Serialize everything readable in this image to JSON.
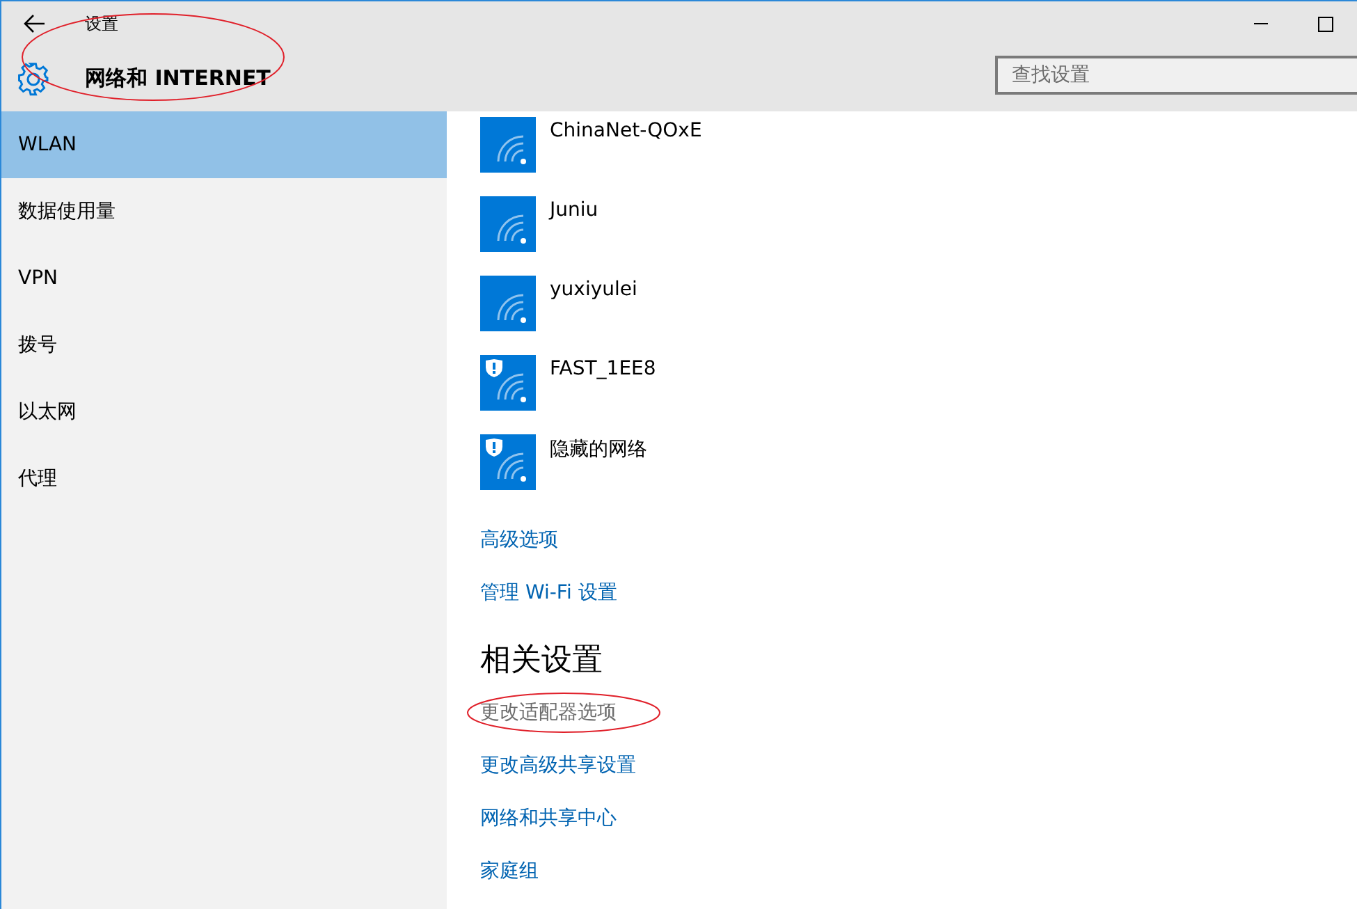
{
  "window": {
    "title": "设置"
  },
  "header": {
    "title": "网络和 INTERNET",
    "search": {
      "placeholder": "查找设置"
    }
  },
  "sidebar": {
    "items": [
      {
        "label": "WLAN",
        "selected": true
      },
      {
        "label": "数据使用量",
        "selected": false
      },
      {
        "label": "VPN",
        "selected": false
      },
      {
        "label": "拨号",
        "selected": false
      },
      {
        "label": "以太网",
        "selected": false
      },
      {
        "label": "代理",
        "selected": false
      }
    ]
  },
  "networks": [
    {
      "name": "ChinaNet-QOxE",
      "warning": false
    },
    {
      "name": "Juniu",
      "warning": false
    },
    {
      "name": "yuxiyulei",
      "warning": false
    },
    {
      "name": "FAST_1EE8",
      "warning": true
    },
    {
      "name": "隐藏的网络",
      "warning": true
    }
  ],
  "links": [
    {
      "label": "高级选项",
      "pressed": false
    },
    {
      "label": "管理 Wi-Fi 设置",
      "pressed": false
    }
  ],
  "related": {
    "heading": "相关设置",
    "links": [
      {
        "label": "更改适配器选项",
        "pressed": true,
        "circled": true
      },
      {
        "label": "更改高级共享设置",
        "pressed": false,
        "circled": false
      },
      {
        "label": "网络和共享中心",
        "pressed": false,
        "circled": false
      },
      {
        "label": "家庭组",
        "pressed": false,
        "circled": false
      }
    ]
  },
  "annotations": {
    "header_circled": true
  }
}
